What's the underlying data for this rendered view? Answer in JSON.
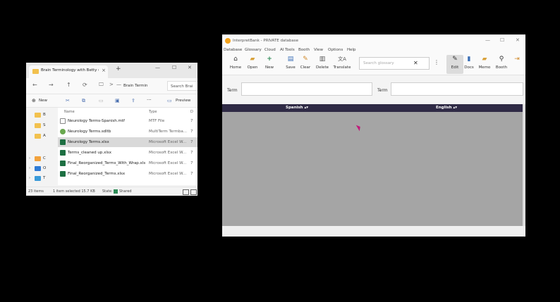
{
  "explorer": {
    "tab_title": "Brain Terminology with Betty (",
    "tab_close": "×",
    "new_tab": "+",
    "minimize": "—",
    "maximize": "☐",
    "close": "✕",
    "nav": {
      "back": "←",
      "forward": "→",
      "up": "↑",
      "refresh": "⟳",
      "monitor": "🖵",
      "chevron": ">",
      "dash": "—"
    },
    "address": "Brain Termin",
    "search_placeholder": "Search Brai",
    "command_bar": {
      "new_label": "New",
      "more": "···",
      "preview_label": "Preview"
    },
    "nav_items": [
      {
        "label": "B"
      },
      {
        "label": "S"
      },
      {
        "label": "A"
      },
      {
        "label": "C"
      },
      {
        "label": "O"
      },
      {
        "label": "T"
      }
    ],
    "columns": {
      "name": "Name",
      "type": "Type",
      "size": "D"
    },
    "files": [
      {
        "name": "Neurology Terms-Spanish.mtf",
        "type": "MTF File",
        "size": "7",
        "icon": "document-icon",
        "color": "#ffffff",
        "selected": false
      },
      {
        "name": "Neurology Terms.sdltb",
        "type": "MultiTerm Termba...",
        "size": "7",
        "icon": "termbase-icon",
        "color": "#6aa84f",
        "selected": false
      },
      {
        "name": "Neurology Terms.xlsx",
        "type": "Microsoft Excel W...",
        "size": "7",
        "icon": "excel-icon",
        "color": "#1d6f42",
        "selected": true
      },
      {
        "name": "Terms_cleaned up.xlsx",
        "type": "Microsoft Excel W...",
        "size": "7",
        "icon": "excel-icon",
        "color": "#1d6f42",
        "selected": false
      },
      {
        "name": "Final_Reorganized_Terms_With_Wrap.xlsx",
        "type": "Microsoft Excel W...",
        "size": "7",
        "icon": "excel-icon",
        "color": "#1d6f42",
        "selected": false
      },
      {
        "name": "Final_Reorganized_Terms.xlsx",
        "type": "Microsoft Excel W...",
        "size": "7",
        "icon": "excel-icon",
        "color": "#1d6f42",
        "selected": false
      }
    ],
    "status": {
      "items": "23 items",
      "selected": "1 item selected  15.7 KB",
      "state": "State:",
      "shared": "Shared"
    }
  },
  "interpretbank": {
    "title": "InterpretBank - PRIVATE database",
    "controls": {
      "minimize": "—",
      "maximize": "☐",
      "close": "✕"
    },
    "menu": [
      "Database",
      "Glossary",
      "Cloud",
      "AI Tools",
      "Booth",
      "View",
      "Options",
      "Help"
    ],
    "toolbar": {
      "home": "Home",
      "open": "Open",
      "new": "New",
      "save": "Save",
      "clear": "Clear",
      "delete": "Delete",
      "translate": "Translate",
      "edit": "Edit",
      "docs": "Docs",
      "memo": "Memo",
      "booth": "Booth"
    },
    "search_placeholder": "Search glossary",
    "search_clear": "✕",
    "more": "⋮",
    "term_label_left": "Term",
    "term_label_right": "Term",
    "col_spanish": "Spanish ▴▾",
    "col_english": "English ▴▾"
  }
}
